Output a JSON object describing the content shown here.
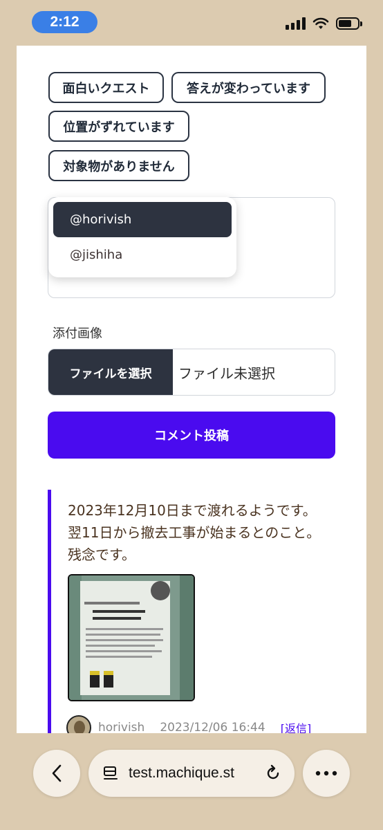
{
  "status": {
    "time": "2:12"
  },
  "chips": [
    {
      "label": "面白いクエスト"
    },
    {
      "label": "答えが変わっています"
    },
    {
      "label": "位置がずれています"
    },
    {
      "label": "対象物がありません"
    }
  ],
  "mentions": [
    {
      "label": "@horivish",
      "selected": true
    },
    {
      "label": "@jishiha",
      "selected": false
    }
  ],
  "attachment": {
    "label": "添付画像",
    "button_label": "ファイルを選択",
    "status": "ファイル未選択"
  },
  "submit_label": "コメント投稿",
  "comment": {
    "lines": [
      "2023年12月10日まで渡れるようです。",
      "翌11日から撤去工事が始まるとのこと。",
      "残念です。"
    ],
    "author": "horivish",
    "timestamp": "2023/12/06 16:44",
    "reply_label": "[返信]"
  },
  "browser": {
    "url": "test.machique.st"
  },
  "colors": {
    "accent": "#4a0bef",
    "dark": "#2d3340",
    "background": "#dccbb0"
  }
}
